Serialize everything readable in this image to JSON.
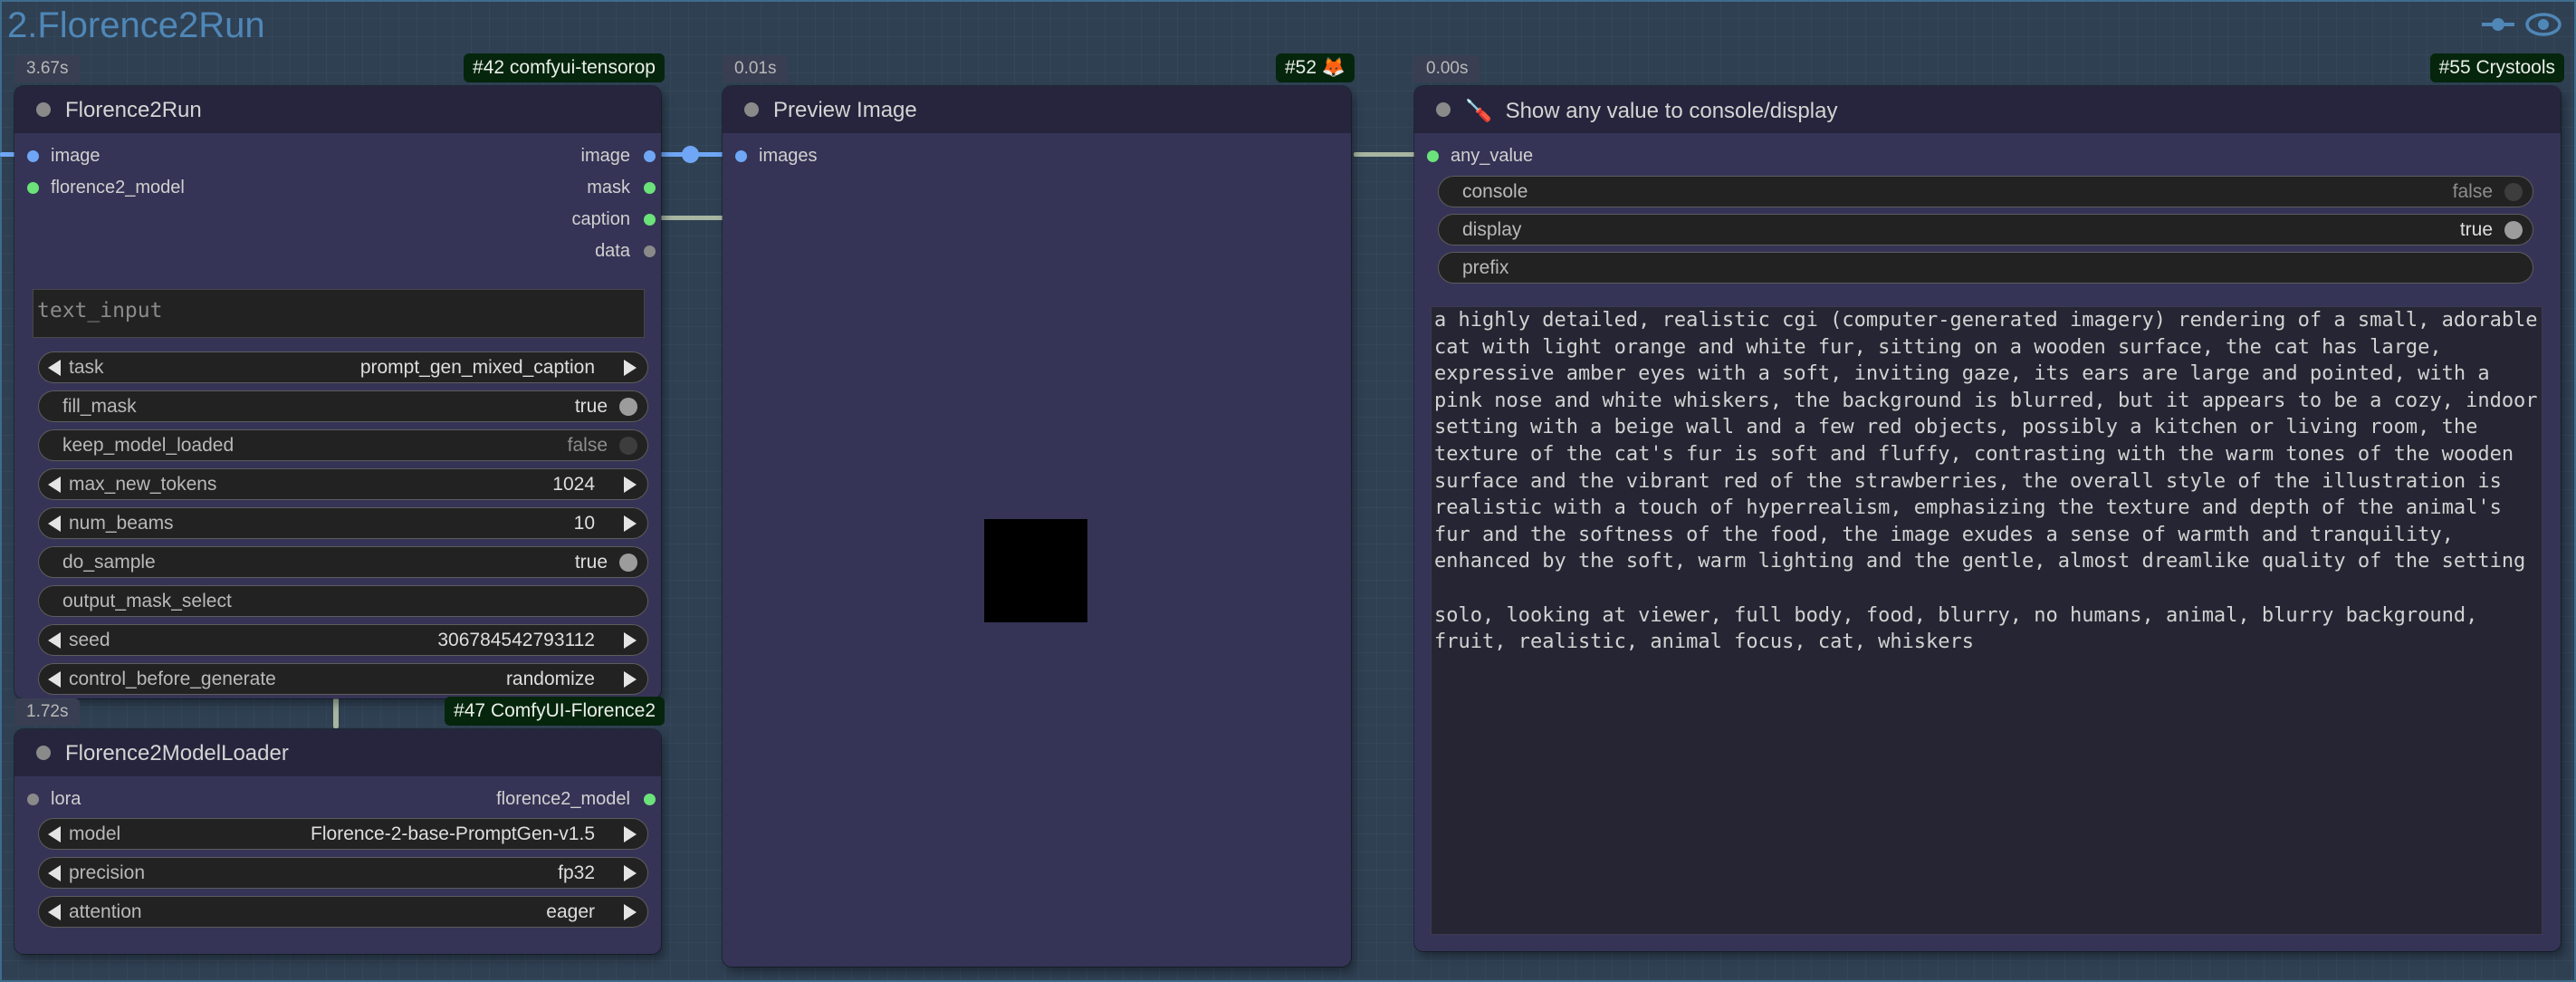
{
  "group": {
    "title": "2.Florence2Run"
  },
  "colors": {
    "badge_bg": "#06250d",
    "node_bg": "#353456",
    "group_border": "#3f6c8c",
    "slot_image": "#6fa7f6",
    "slot_model": "#6ce27a"
  },
  "icons": [
    "link-icon",
    "eye-icon"
  ],
  "florence2run": {
    "timer": "3.67s",
    "badge": "#42 comfyui-tensorop",
    "title": "Florence2Run",
    "inputs": [
      "image",
      "florence2_model"
    ],
    "outputs": [
      "image",
      "mask",
      "caption",
      "data"
    ],
    "text_input_placeholder": "text_input",
    "widgets": {
      "task": {
        "label": "task",
        "value": "prompt_gen_mixed_caption"
      },
      "fill_mask": {
        "label": "fill_mask",
        "value": "true"
      },
      "keep_model_loaded": {
        "label": "keep_model_loaded",
        "value": "false"
      },
      "max_new_tokens": {
        "label": "max_new_tokens",
        "value": "1024"
      },
      "num_beams": {
        "label": "num_beams",
        "value": "10"
      },
      "do_sample": {
        "label": "do_sample",
        "value": "true"
      },
      "output_mask_select": {
        "label": "output_mask_select",
        "value": ""
      },
      "seed": {
        "label": "seed",
        "value": "306784542793112"
      },
      "control_before_generate": {
        "label": "control_before_generate",
        "value": "randomize"
      }
    }
  },
  "loader": {
    "timer": "1.72s",
    "badge": "#47 ComfyUI-Florence2",
    "title": "Florence2ModelLoader",
    "inputs": [
      "lora"
    ],
    "outputs": [
      "florence2_model"
    ],
    "widgets": {
      "model": {
        "label": "model",
        "value": "Florence-2-base-PromptGen-v1.5"
      },
      "precision": {
        "label": "precision",
        "value": "fp32"
      },
      "attention": {
        "label": "attention",
        "value": "eager"
      }
    }
  },
  "preview": {
    "timer": "0.01s",
    "badge": "#52 🦊",
    "title": "Preview Image",
    "inputs": [
      "images"
    ]
  },
  "display": {
    "timer": "0.00s",
    "badge": "#55 Crystools",
    "title_icon": "🪛",
    "title": "Show any value to console/display",
    "inputs": [
      "any_value"
    ],
    "widgets": {
      "console": {
        "label": "console",
        "value": "false"
      },
      "display": {
        "label": "display",
        "value": "true"
      },
      "prefix": {
        "label": "prefix",
        "value": ""
      }
    },
    "output_text": "a highly detailed, realistic cgi (computer-generated imagery) rendering of a small, adorable cat with light orange and white fur, sitting on a wooden surface, the cat has large, expressive amber eyes with a soft, inviting gaze, its ears are large and pointed, with a pink nose and white whiskers, the background is blurred, but it appears to be a cozy, indoor setting with a beige wall and a few red objects, possibly a kitchen or living room, the texture of the cat's fur is soft and fluffy, contrasting with the warm tones of the wooden surface and the vibrant red of the strawberries, the overall style of the illustration is realistic with a touch of hyperrealism, emphasizing the texture and depth of the animal's fur and the softness of the food, the image exudes a sense of warmth and tranquility, enhanced by the soft, warm lighting and the gentle, almost dreamlike quality of the setting\n\nsolo, looking at viewer, full body, food, blurry, no humans, animal, blurry background, fruit, realistic, animal focus, cat, whiskers"
  }
}
